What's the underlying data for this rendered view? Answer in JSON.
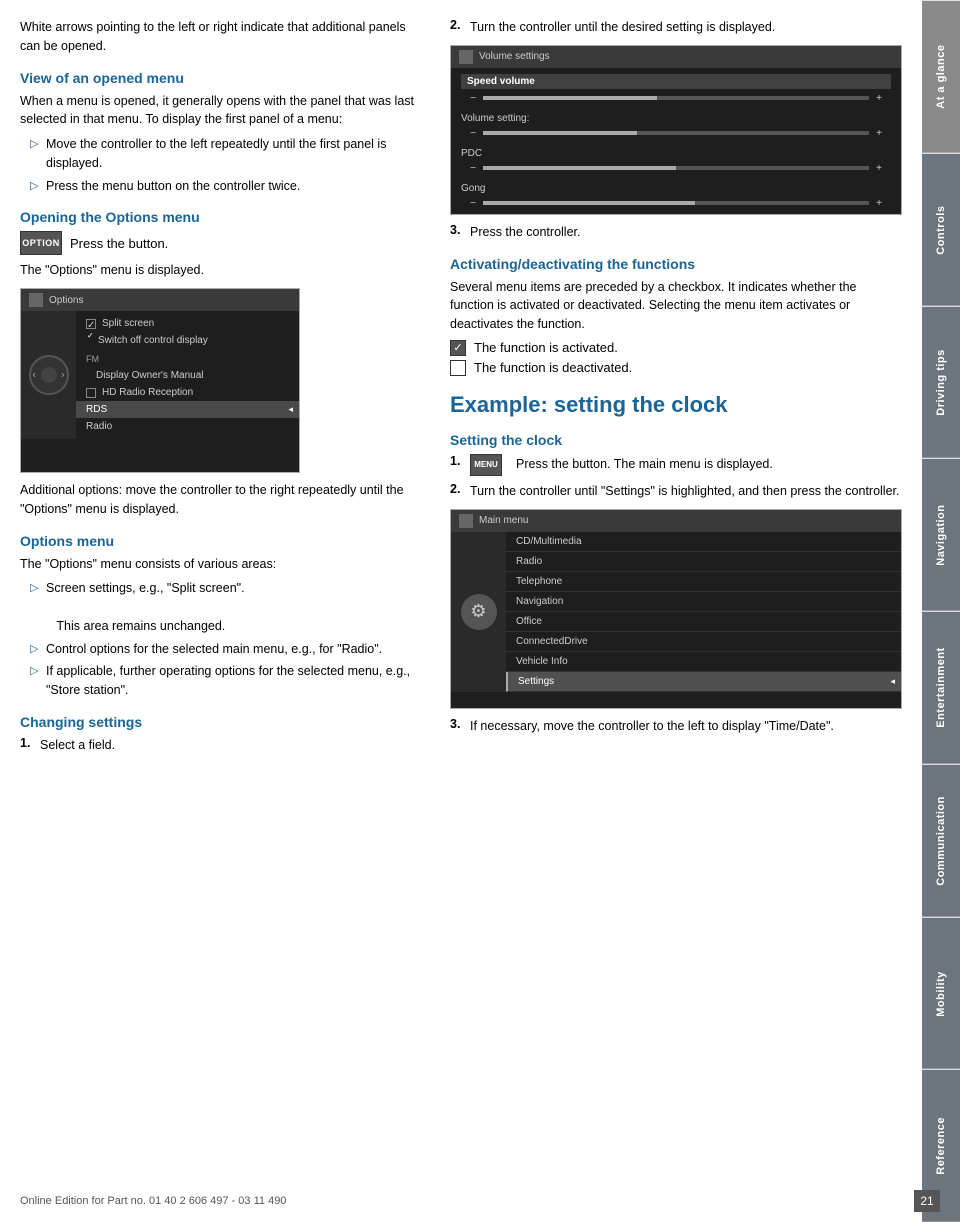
{
  "page": {
    "number": "21",
    "footer": "Online Edition for Part no. 01 40 2 606 497 - 03 11 490"
  },
  "sidebar": {
    "tabs": [
      {
        "label": "At a glance",
        "active": true
      },
      {
        "label": "Controls",
        "active": false
      },
      {
        "label": "Driving tips",
        "active": false
      },
      {
        "label": "Navigation",
        "active": false
      },
      {
        "label": "Entertainment",
        "active": false
      },
      {
        "label": "Communication",
        "active": false
      },
      {
        "label": "Mobility",
        "active": false
      },
      {
        "label": "Reference",
        "active": false
      }
    ]
  },
  "sections": {
    "intro": "White arrows pointing to the left or right indicate that additional panels can be opened.",
    "opened_menu": {
      "heading": "View of an opened menu",
      "body": "When a menu is opened, it generally opens with the panel that was last selected in that menu. To display the first panel of a menu:",
      "bullets": [
        "Move the controller to the left repeatedly until the first panel is displayed.",
        "Press the menu button on the controller twice."
      ]
    },
    "options_menu_heading": "Opening the Options menu",
    "options_button_label": "OPTION",
    "options_press_text": "Press the button.",
    "options_displayed_text": "The \"Options\" menu is displayed.",
    "options_additional_text": "Additional options: move the controller to the right repeatedly until the \"Options\" menu is displayed.",
    "options_menu_sub": {
      "heading": "Options menu",
      "body": "The \"Options\" menu consists of various areas:",
      "bullets": [
        "Screen settings, e.g., \"Split screen\".\n\nThis area remains unchanged.",
        "Control options for the selected main menu, e.g., for \"Radio\".",
        "If applicable, further operating options for the selected menu, e.g., \"Store station\"."
      ]
    },
    "changing_settings": {
      "heading": "Changing settings",
      "step1": "Select a field."
    },
    "right_column": {
      "step2": "Turn the controller until the desired setting is displayed.",
      "step3": "Press the controller.",
      "activating_heading": "Activating/deactivating the functions",
      "activating_body": "Several menu items are preceded by a checkbox. It indicates whether the function is activated or deactivated. Selecting the menu item activates or deactivates the function.",
      "function_activated": "The function is activated.",
      "function_deactivated": "The function is deactivated.",
      "example_heading": "Example: setting the clock",
      "setting_clock_heading": "Setting the clock",
      "clock_step1": "Press the button.  The main menu is displayed.",
      "clock_step2": "Turn the controller until \"Settings\" is highlighted, and then press the controller.",
      "clock_step3": "If necessary, move the controller to the left to display \"Time/Date\"."
    }
  },
  "options_screenshot": {
    "header": "Options",
    "items": [
      {
        "text": "Split screen",
        "type": "checked",
        "indent": false
      },
      {
        "text": "Switch off control display",
        "type": "normal",
        "indent": true
      },
      {
        "text": "FM",
        "type": "group",
        "indent": false
      },
      {
        "text": "Display Owner's Manual",
        "type": "normal",
        "indent": true
      },
      {
        "text": "HD Radio Reception",
        "type": "checkbox",
        "indent": false
      },
      {
        "text": "RDS",
        "type": "highlighted",
        "indent": false
      },
      {
        "text": "Radio",
        "type": "normal",
        "indent": false
      }
    ]
  },
  "volume_screenshot": {
    "header": "Volume settings",
    "speed_volume_label": "Speed volume",
    "items": [
      {
        "label": "Volume setting:",
        "value": 40
      },
      {
        "label": "PDC",
        "value": 50
      },
      {
        "label": "Gong",
        "value": 55
      }
    ]
  },
  "main_menu_screenshot": {
    "header": "Main menu",
    "items": [
      "CD/Multimedia",
      "Radio",
      "Telephone",
      "Navigation",
      "Office",
      "ConnectedDrive",
      "Vehicle Info",
      "Settings"
    ],
    "highlighted": "Settings"
  }
}
